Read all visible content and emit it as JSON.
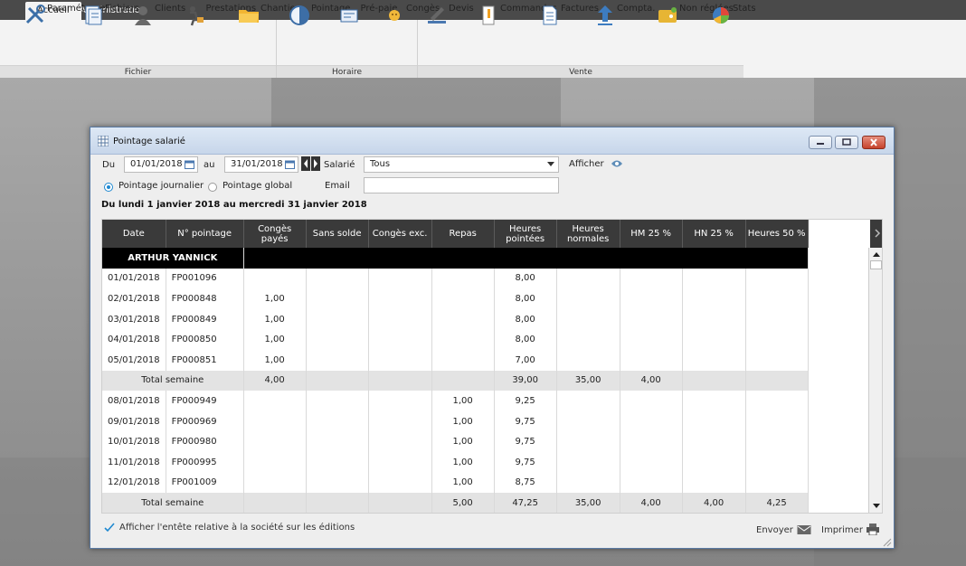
{
  "tabs": [
    {
      "label": "Accueil"
    },
    {
      "label": "Administration"
    }
  ],
  "ribbon": {
    "buttons": [
      {
        "label": "Paramétrage"
      },
      {
        "label": "Fichiers"
      },
      {
        "label": "Clients"
      },
      {
        "label": "Prestations"
      },
      {
        "label": "Chantiers"
      },
      {
        "label": "Pointage"
      },
      {
        "label": "Pré-paie"
      },
      {
        "label": "Congès"
      },
      {
        "label": "Devis"
      },
      {
        "label": "Commandes"
      },
      {
        "label": "Factures"
      },
      {
        "label": "Compta."
      },
      {
        "label": "Non réglées"
      },
      {
        "label": "Stats"
      }
    ],
    "groups": [
      {
        "label": "Fichier"
      },
      {
        "label": "Horaire"
      },
      {
        "label": "Vente"
      }
    ]
  },
  "window": {
    "title": "Pointage salarié",
    "du_label": "Du",
    "au_label": "au",
    "date_from": "01/01/2018",
    "date_to": "31/01/2018",
    "salarie_label": "Salarié",
    "salarie_value": "Tous",
    "afficher_label": "Afficher",
    "email_label": "Email",
    "email_value": "",
    "radio_journalier": "Pointage journalier",
    "radio_global": "Pointage global",
    "period_heading": "Du lundi 1 janvier 2018 au mercredi 31 janvier 2018",
    "columns": [
      "Date",
      "N° pointage",
      "Congès payés",
      "Sans solde",
      "Congès exc.",
      "Repas",
      "Heures pointées",
      "Heures normales",
      "HM 25 %",
      "HN 25 %",
      "Heures 50 %"
    ],
    "employee": "ARTHUR YANNICK",
    "rows": [
      {
        "type": "day",
        "cells": [
          "01/01/2018",
          "FP001096",
          "",
          "",
          "",
          "",
          "8,00",
          "",
          "",
          "",
          ""
        ]
      },
      {
        "type": "day",
        "cells": [
          "02/01/2018",
          "FP000848",
          "1,00",
          "",
          "",
          "",
          "8,00",
          "",
          "",
          "",
          ""
        ]
      },
      {
        "type": "day",
        "cells": [
          "03/01/2018",
          "FP000849",
          "1,00",
          "",
          "",
          "",
          "8,00",
          "",
          "",
          "",
          ""
        ]
      },
      {
        "type": "day",
        "cells": [
          "04/01/2018",
          "FP000850",
          "1,00",
          "",
          "",
          "",
          "8,00",
          "",
          "",
          "",
          ""
        ]
      },
      {
        "type": "day",
        "cells": [
          "05/01/2018",
          "FP000851",
          "1,00",
          "",
          "",
          "",
          "7,00",
          "",
          "",
          "",
          ""
        ]
      },
      {
        "type": "total",
        "cells": [
          "Total semaine",
          "4,00",
          "",
          "",
          "",
          "39,00",
          "35,00",
          "4,00",
          "",
          ""
        ]
      },
      {
        "type": "day",
        "cells": [
          "08/01/2018",
          "FP000949",
          "",
          "",
          "",
          "1,00",
          "9,25",
          "",
          "",
          "",
          ""
        ]
      },
      {
        "type": "day",
        "cells": [
          "09/01/2018",
          "FP000969",
          "",
          "",
          "",
          "1,00",
          "9,75",
          "",
          "",
          "",
          ""
        ]
      },
      {
        "type": "day",
        "cells": [
          "10/01/2018",
          "FP000980",
          "",
          "",
          "",
          "1,00",
          "9,75",
          "",
          "",
          "",
          ""
        ]
      },
      {
        "type": "day",
        "cells": [
          "11/01/2018",
          "FP000995",
          "",
          "",
          "",
          "1,00",
          "9,75",
          "",
          "",
          "",
          ""
        ]
      },
      {
        "type": "day",
        "cells": [
          "12/01/2018",
          "FP001009",
          "",
          "",
          "",
          "1,00",
          "8,75",
          "",
          "",
          "",
          ""
        ]
      },
      {
        "type": "total",
        "cells": [
          "Total semaine",
          "",
          "",
          "",
          "5,00",
          "47,25",
          "35,00",
          "4,00",
          "4,00",
          "4,25"
        ]
      }
    ],
    "checkbox_label": "Afficher l'entête relative à la société sur les éditions",
    "envoyer_label": "Envoyer",
    "imprimer_label": "Imprimer"
  }
}
